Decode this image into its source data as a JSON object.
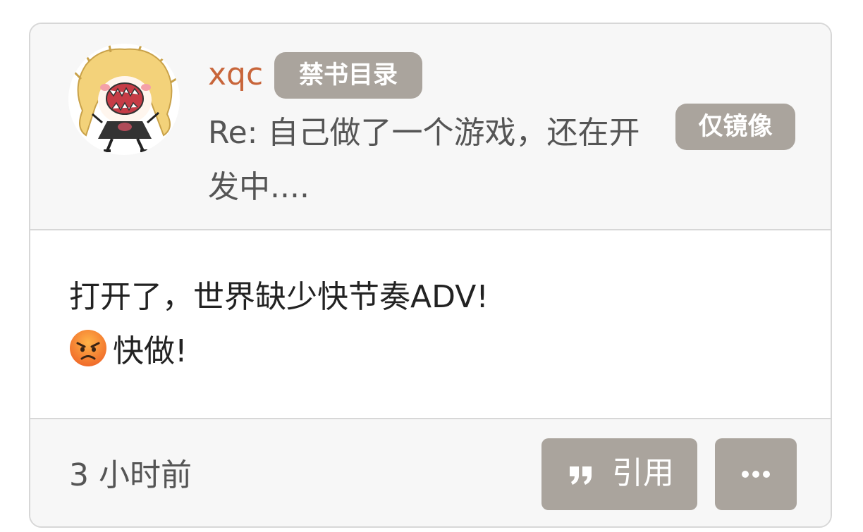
{
  "post": {
    "username": "xqc",
    "user_tag": "禁书目录",
    "thread_title": "Re: 自己做了一个游戏，还在开发中....",
    "mirror_badge": "仅镜像",
    "content_line1": "打开了，世界缺少快节奏ADV!",
    "content_line2": "快做!",
    "content_emoji": "angry-face-icon",
    "time_ago": "3 小时前"
  },
  "actions": {
    "quote_label": "引用",
    "quote_icon": "quote-icon",
    "more_icon": "more-icon"
  },
  "colors": {
    "username": "#c8653a",
    "badge_bg": "#aaa49d",
    "header_bg": "#f7f7f7",
    "border": "#d7d7d7"
  }
}
